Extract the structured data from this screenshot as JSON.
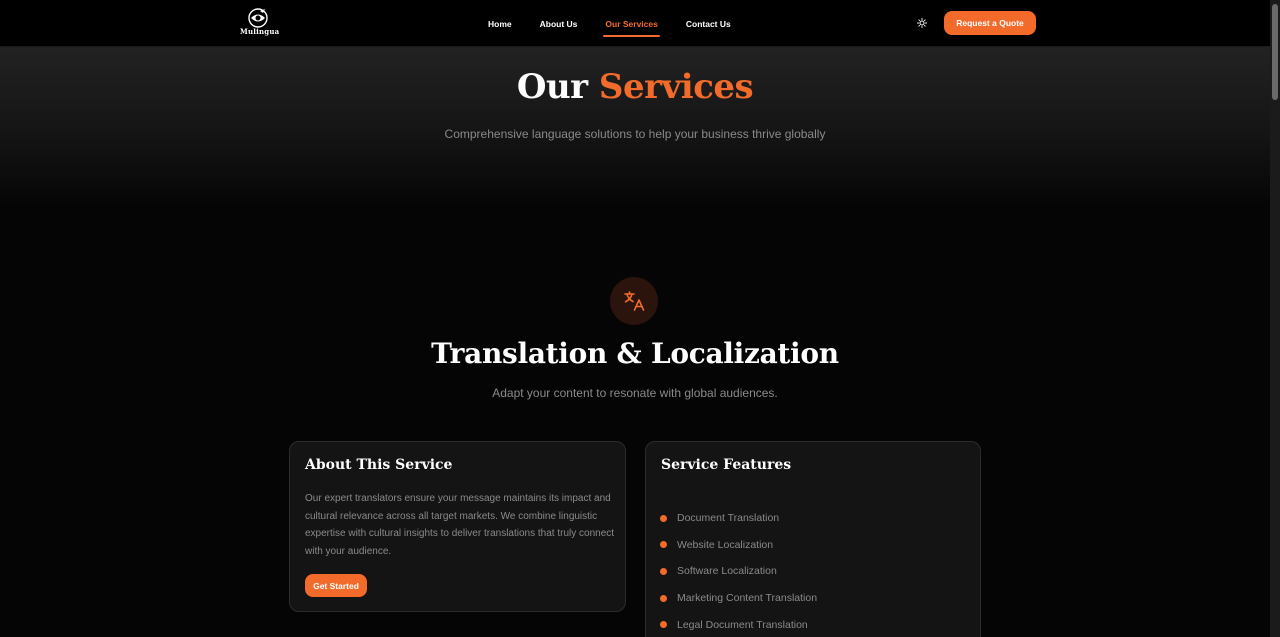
{
  "nav": {
    "logo_text": "Mulingua",
    "links": [
      "Home",
      "About Us",
      "Our Services",
      "Contact Us"
    ],
    "active_link": "Our Services",
    "theme_icon": "sun-icon",
    "cta_label": "Request a Quote"
  },
  "hero": {
    "title_main": "Our",
    "title_accent": "Services",
    "subtitle": "Comprehensive language solutions to help your business thrive globally"
  },
  "service": {
    "icon": "translate-icon",
    "title": "Translation & Localization",
    "subtitle": "Adapt your content to resonate with global audiences.",
    "about": {
      "title": "About This Service",
      "body": "Our expert translators ensure your message maintains its impact and cultural relevance across all target markets. We combine linguistic expertise with cultural insights to deliver translations that truly connect with your audience.",
      "button_label": "Get Started"
    },
    "features": {
      "title": "Service Features",
      "items": [
        "Document Translation",
        "Website Localization",
        "Software Localization",
        "Marketing Content Translation",
        "Legal Document Translation"
      ]
    }
  },
  "colors": {
    "accent": "#f36b2a",
    "background": "#050505",
    "card": "#141414",
    "muted_text": "#8a8a8a"
  }
}
